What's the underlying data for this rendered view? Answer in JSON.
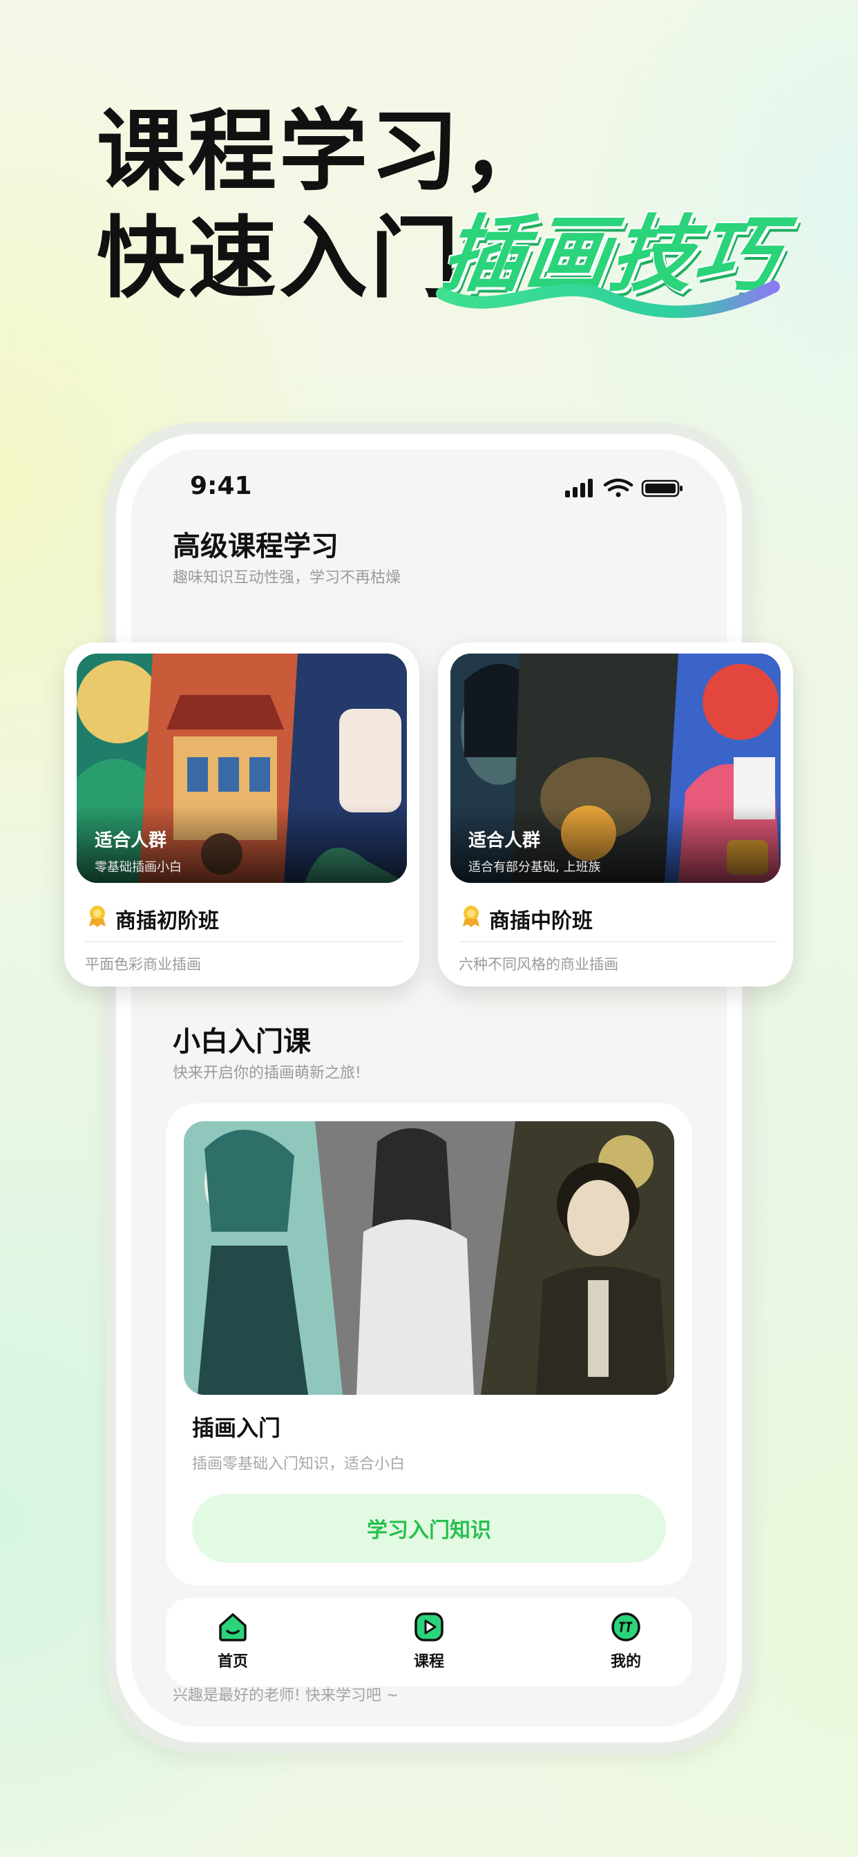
{
  "headline": {
    "line1": "课程学习，",
    "line2": "快速入门",
    "accent": "插画技巧"
  },
  "status_bar": {
    "time": "9:41"
  },
  "advanced": {
    "title": "高级课程学习",
    "subtitle": "趣味知识互动性强，学习不再枯燥",
    "cards": [
      {
        "image_tag_title": "适合人群",
        "image_tag_sub": "零基础插画小白",
        "name": "商插初阶班",
        "desc": "平面色彩商业插画"
      },
      {
        "image_tag_title": "适合人群",
        "image_tag_sub": "适合有部分基础, 上班族",
        "name": "商插中阶班",
        "desc": "六种不同风格的商业插画"
      }
    ]
  },
  "beginner": {
    "title": "小白入门课",
    "subtitle": "快来开启你的插画萌新之旅!",
    "card": {
      "name": "插画入门",
      "desc": "插画零基础入门知识，适合小白",
      "button": "学习入门知识"
    }
  },
  "nav": {
    "items": [
      {
        "label": "首页",
        "icon": "home-icon"
      },
      {
        "label": "课程",
        "icon": "course-play-icon"
      },
      {
        "label": "我的",
        "icon": "profile-icon"
      }
    ]
  },
  "footer_note": "兴趣是最好的老师! 快来学习吧 ~",
  "colors": {
    "accent": "#2bd37a",
    "button_bg": "#e3fae2",
    "button_text": "#27bf4f"
  }
}
